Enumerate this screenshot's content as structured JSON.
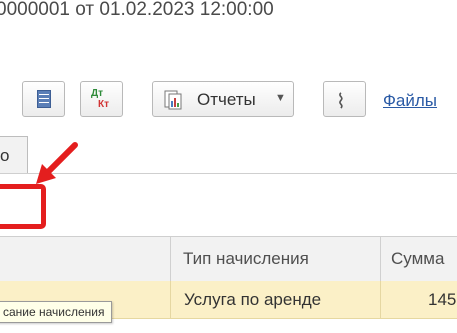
{
  "header": {
    "title": "0000001 от 01.02.2023 12:00:00"
  },
  "toolbar": {
    "list_icon": "list-icon",
    "dtkt": {
      "dt": "Дт",
      "kt": "Кт"
    },
    "reports_label": "Отчеты",
    "attach_icon": "paperclip-icon",
    "files_label": "Файлы"
  },
  "tab": {
    "label": "о"
  },
  "table": {
    "columns": [
      "Тип начисления",
      "Сумма"
    ],
    "rows": [
      {
        "type": "Услуга по аренде",
        "amount": "145"
      }
    ]
  },
  "tooltip": {
    "text": "сание начисления"
  },
  "colors": {
    "highlight_box": "#e41e1e",
    "selected_row": "#fbf0c7",
    "link": "#2a5aa5"
  }
}
